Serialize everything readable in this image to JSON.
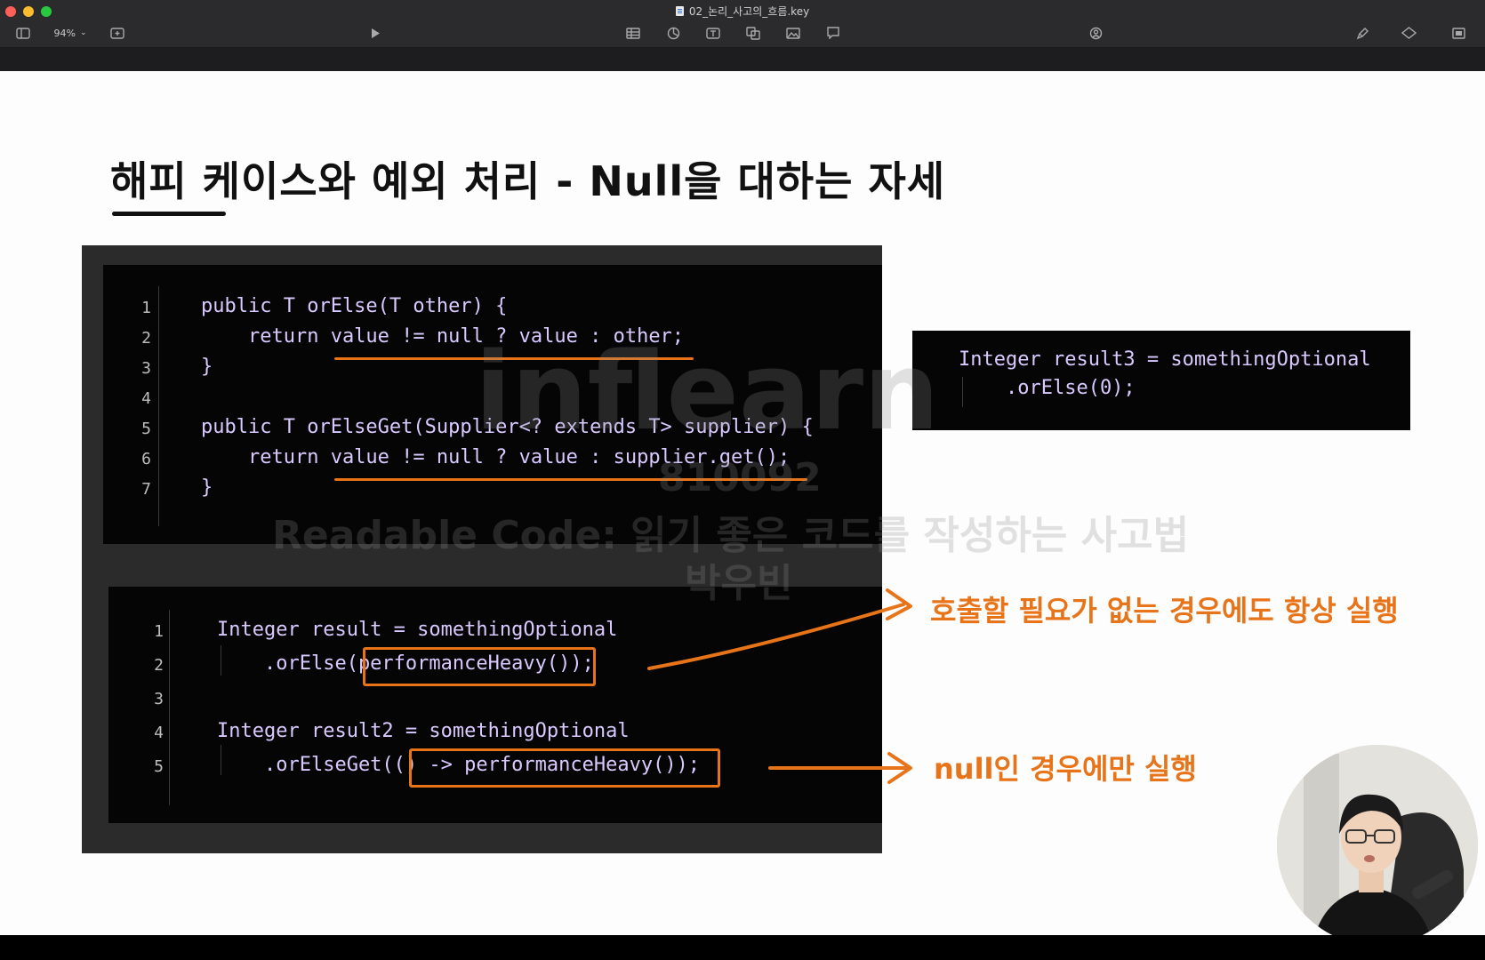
{
  "window": {
    "title": "02_논리_사고의_흐름.key",
    "zoom": "94%"
  },
  "toolbar": {
    "icons": [
      "sidebar-icon",
      "zoom-dropdown",
      "add-slide-icon",
      "play-icon",
      "table-icon",
      "chart-icon",
      "text-icon",
      "shape-icon",
      "media-icon",
      "comment-icon",
      "collaborate-icon",
      "format-icon",
      "animate-icon",
      "document-icon"
    ]
  },
  "slide": {
    "title": "해피 케이스와 예외 처리 - Null을 대하는 자세",
    "code1": {
      "line_numbers": [
        "1",
        "2",
        "3",
        "4",
        "5",
        "6",
        "7"
      ],
      "lines": [
        "public T orElse(T other) {",
        "    return value != null ? value : other;",
        "}",
        "",
        "public T orElseGet(Supplier<? extends T> supplier) {",
        "    return value != null ? value : supplier.get();",
        "}"
      ]
    },
    "code2": {
      "line_numbers": [
        "1",
        "2",
        "3",
        "4",
        "5"
      ],
      "lines": [
        "Integer result = somethingOptional",
        "    .orElse(performanceHeavy());",
        "",
        "Integer result2 = somethingOptional",
        "    .orElseGet(() -> performanceHeavy());"
      ]
    },
    "code3": {
      "lines": [
        "Integer result3 = somethingOptional",
        "    .orElse(0);"
      ]
    },
    "annotation_always": "호출할 필요가 없는 경우에도 항상 실행",
    "annotation_null_only": "null인 경우에만 실행",
    "watermark": {
      "logo": "inflearn",
      "id": "810092",
      "course": "Readable Code: 읽기 좋은 코드를 작성하는 사고법",
      "author": "박우빈"
    }
  },
  "colors": {
    "accent": "#e8741a",
    "code_bg": "#050505",
    "panel_bg": "#2b2b2b",
    "slide_bg": "#fdfdfd"
  }
}
